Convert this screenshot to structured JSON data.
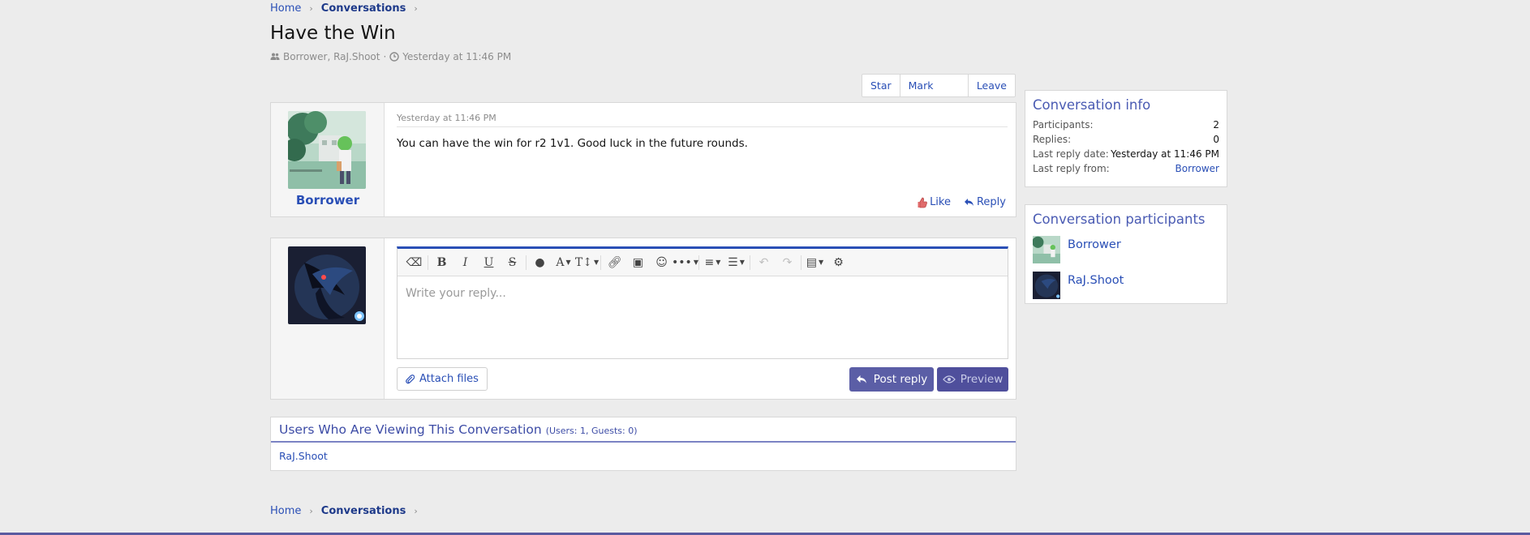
{
  "breadcrumb": {
    "home": "Home",
    "current": "Conversations",
    "sep": "›"
  },
  "conversation": {
    "title": "Have the Win",
    "participants_meta": "Borrower, RaJ.Shoot",
    "meta_sep": "·",
    "time_meta": "Yesterday at 11:46 PM"
  },
  "actions": {
    "star": "Star",
    "mark_unread": "Mark unread",
    "leave": "Leave"
  },
  "message": {
    "author": "Borrower",
    "time": "Yesterday at 11:46 PM",
    "body": "You can have the win for r2 1v1. Good luck in the future rounds.",
    "like": "Like",
    "reply": "Reply"
  },
  "editor": {
    "placeholder": "Write your reply...",
    "attach": "Attach files",
    "post": "Post reply",
    "preview": "Preview",
    "accent": "#2a4fb6"
  },
  "viewing": {
    "title": "Users Who Are Viewing This Conversation",
    "stats": "(Users: 1, Guests: 0)",
    "users": "RaJ.Shoot"
  },
  "info": {
    "title": "Conversation info",
    "rows": [
      {
        "k": "Participants:",
        "v": "2"
      },
      {
        "k": "Replies:",
        "v": "0"
      },
      {
        "k": "Last reply date:",
        "v": "Yesterday at 11:46 PM"
      },
      {
        "k": "Last reply from:",
        "v": "Borrower"
      }
    ]
  },
  "participants": {
    "title": "Conversation participants",
    "list": [
      {
        "name": "Borrower"
      },
      {
        "name": "RaJ.Shoot"
      }
    ]
  },
  "colors": {
    "link": "#2a4fb6",
    "header": "#4a5bb3",
    "button": "#5b5ea6"
  }
}
